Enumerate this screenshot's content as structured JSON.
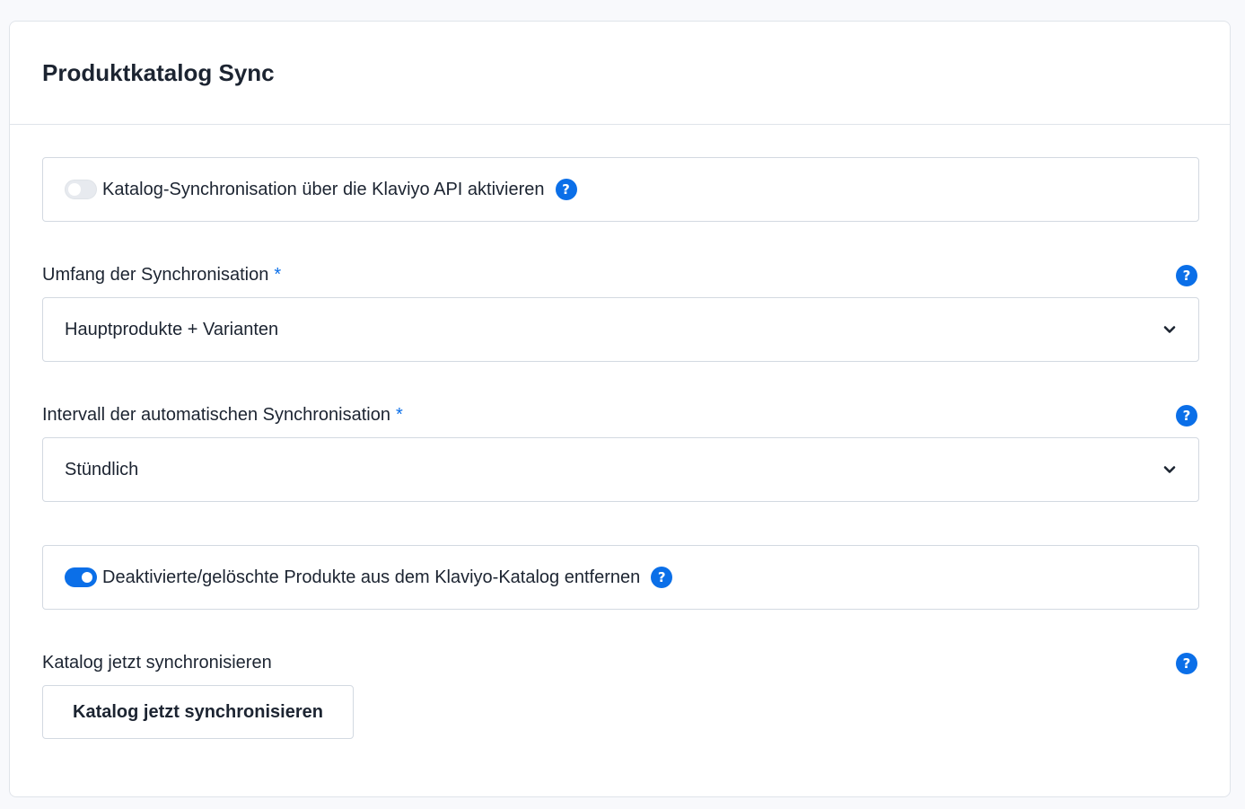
{
  "card": {
    "title": "Produktkatalog Sync"
  },
  "catalog_sync_toggle": {
    "label": "Katalog-Synchronisation über die Klaviyo API aktivieren",
    "enabled": false,
    "help_icon": "question-icon",
    "help_glyph": "?"
  },
  "sync_scope": {
    "label": "Umfang der Synchronisation",
    "required_marker": "*",
    "value": "Hauptprodukte + Varianten",
    "help_glyph": "?",
    "dropdown_icon": "chevron-down-icon"
  },
  "sync_interval": {
    "label": "Intervall der automatischen Synchronisation",
    "required_marker": "*",
    "value": "Stündlich",
    "help_glyph": "?",
    "dropdown_icon": "chevron-down-icon"
  },
  "remove_products_toggle": {
    "label": "Deaktivierte/gelöschte Produkte aus dem Klaviyo-Katalog entfernen",
    "enabled": true,
    "help_glyph": "?"
  },
  "sync_now": {
    "label": "Katalog jetzt synchronisieren",
    "button_label": "Katalog jetzt synchronisieren",
    "help_glyph": "?"
  },
  "colors": {
    "accent": "#0b6fe8",
    "text": "#1c2431",
    "border": "#d3d9e1",
    "background": "#f8f9fc",
    "toggle_off": "#e7eaef"
  }
}
